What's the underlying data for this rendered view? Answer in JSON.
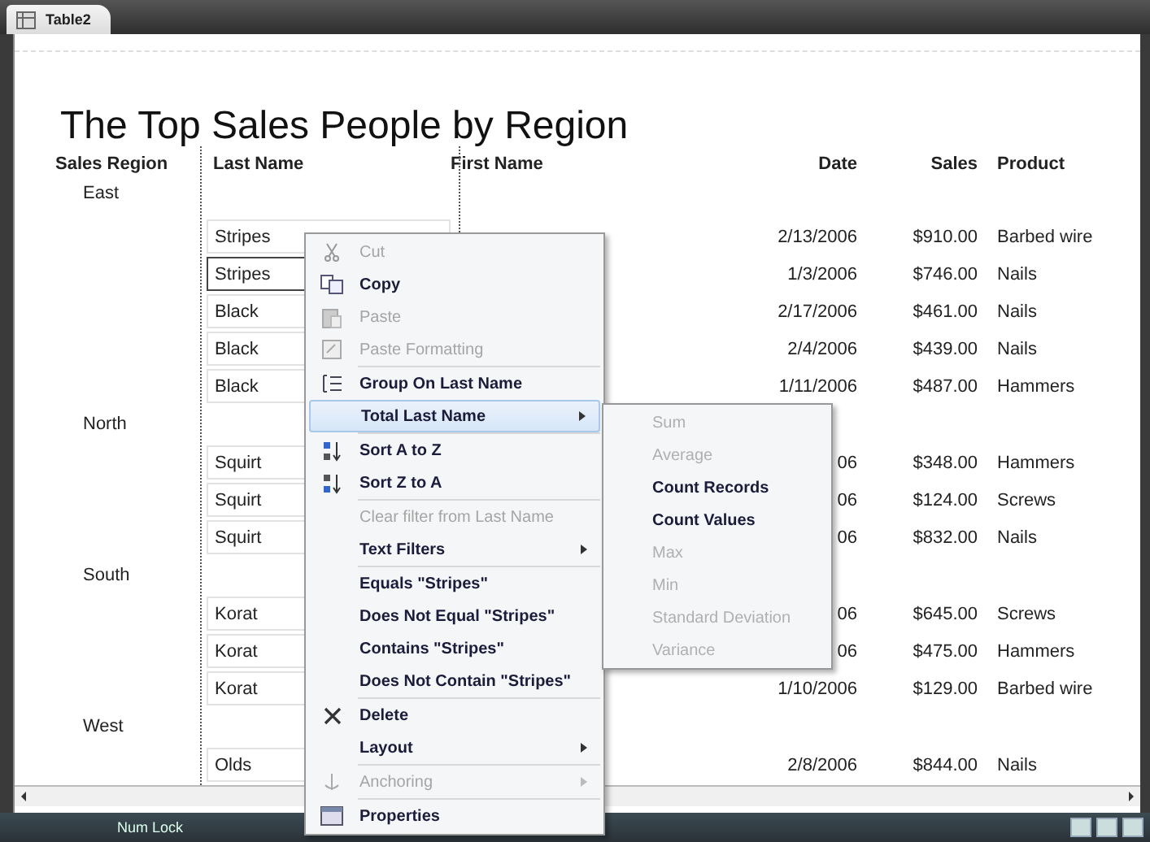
{
  "tab": {
    "label": "Table2"
  },
  "report": {
    "title": "The Top Sales People by Region",
    "columns": [
      "Sales Region",
      "Last Name",
      "First Name",
      "Date",
      "Sales",
      "Product"
    ],
    "groups": [
      {
        "region": "East",
        "rows": [
          {
            "last_name": "Stripes",
            "date": "2/13/2006",
            "sales": "$910.00",
            "product": "Barbed wire",
            "selected": false
          },
          {
            "last_name": "Stripes",
            "date": "1/3/2006",
            "sales": "$746.00",
            "product": "Nails",
            "selected": true
          },
          {
            "last_name": "Black",
            "date": "2/17/2006",
            "sales": "$461.00",
            "product": "Nails",
            "selected": false
          },
          {
            "last_name": "Black",
            "date": "2/4/2006",
            "sales": "$439.00",
            "product": "Nails",
            "selected": false
          },
          {
            "last_name": "Black",
            "date": "1/11/2006",
            "sales": "$487.00",
            "product": "Hammers",
            "selected": false
          }
        ]
      },
      {
        "region": "North",
        "rows": [
          {
            "last_name": "Squirt",
            "date": "06",
            "sales": "$348.00",
            "product": "Hammers",
            "selected": false
          },
          {
            "last_name": "Squirt",
            "date": "06",
            "sales": "$124.00",
            "product": "Screws",
            "selected": false
          },
          {
            "last_name": "Squirt",
            "date": "06",
            "sales": "$832.00",
            "product": "Nails",
            "selected": false
          }
        ]
      },
      {
        "region": "South",
        "rows": [
          {
            "last_name": "Korat",
            "date": "06",
            "sales": "$645.00",
            "product": "Screws",
            "selected": false
          },
          {
            "last_name": "Korat",
            "date": "06",
            "sales": "$475.00",
            "product": "Hammers",
            "selected": false
          },
          {
            "last_name": "Korat",
            "date": "1/10/2006",
            "sales": "$129.00",
            "product": "Barbed wire",
            "selected": false
          }
        ]
      },
      {
        "region": "West",
        "rows": [
          {
            "last_name": "Olds",
            "date": "2/8/2006",
            "sales": "$844.00",
            "product": "Nails",
            "selected": false
          }
        ]
      }
    ]
  },
  "context_menu": {
    "items": [
      {
        "label": "Cut",
        "disabled": true,
        "selected": false,
        "submenu": false,
        "separator_before": false
      },
      {
        "label": "Copy",
        "disabled": false,
        "selected": false,
        "submenu": false,
        "separator_before": false
      },
      {
        "label": "Paste",
        "disabled": true,
        "selected": false,
        "submenu": false,
        "separator_before": false
      },
      {
        "label": "Paste Formatting",
        "disabled": true,
        "selected": false,
        "submenu": false,
        "separator_before": false
      },
      {
        "label": "Group On Last Name",
        "disabled": false,
        "selected": false,
        "submenu": false,
        "separator_before": true
      },
      {
        "label": "Total Last Name",
        "disabled": false,
        "selected": true,
        "submenu": true,
        "separator_before": false
      },
      {
        "label": "Sort A to Z",
        "disabled": false,
        "selected": false,
        "submenu": false,
        "separator_before": true
      },
      {
        "label": "Sort Z to A",
        "disabled": false,
        "selected": false,
        "submenu": false,
        "separator_before": false
      },
      {
        "label": "Clear filter from Last Name",
        "disabled": true,
        "selected": false,
        "submenu": false,
        "separator_before": true
      },
      {
        "label": "Text Filters",
        "disabled": false,
        "selected": false,
        "submenu": true,
        "separator_before": false
      },
      {
        "label": "Equals \"Stripes\"",
        "disabled": false,
        "selected": false,
        "submenu": false,
        "separator_before": true
      },
      {
        "label": "Does Not Equal \"Stripes\"",
        "disabled": false,
        "selected": false,
        "submenu": false,
        "separator_before": false
      },
      {
        "label": "Contains \"Stripes\"",
        "disabled": false,
        "selected": false,
        "submenu": false,
        "separator_before": false
      },
      {
        "label": "Does Not Contain \"Stripes\"",
        "disabled": false,
        "selected": false,
        "submenu": false,
        "separator_before": false
      },
      {
        "label": "Delete",
        "disabled": false,
        "selected": false,
        "submenu": false,
        "separator_before": true
      },
      {
        "label": "Layout",
        "disabled": false,
        "selected": false,
        "submenu": true,
        "separator_before": false
      },
      {
        "label": "Anchoring",
        "disabled": true,
        "selected": false,
        "submenu": true,
        "separator_before": true
      },
      {
        "label": "Properties",
        "disabled": false,
        "selected": false,
        "submenu": false,
        "separator_before": true
      }
    ]
  },
  "submenu": {
    "items": [
      {
        "label": "Sum",
        "disabled": true
      },
      {
        "label": "Average",
        "disabled": true
      },
      {
        "label": "Count Records",
        "disabled": false
      },
      {
        "label": "Count Values",
        "disabled": false
      },
      {
        "label": "Max",
        "disabled": true
      },
      {
        "label": "Min",
        "disabled": true
      },
      {
        "label": "Standard Deviation",
        "disabled": true
      },
      {
        "label": "Variance",
        "disabled": true
      }
    ]
  },
  "status_bar": {
    "text": "Num Lock"
  }
}
